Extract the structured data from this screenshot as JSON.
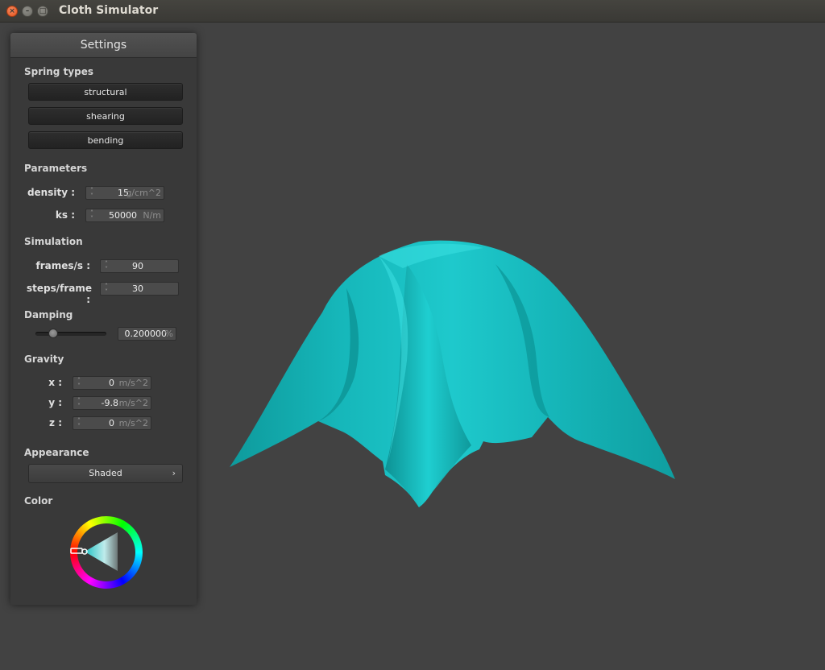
{
  "window": {
    "title": "Cloth Simulator",
    "close_glyph": "×",
    "minimize_glyph": "–",
    "maximize_glyph": "□"
  },
  "settings": {
    "header": "Settings",
    "spring_types": {
      "label": "Spring types",
      "buttons": [
        "structural",
        "shearing",
        "bending"
      ]
    },
    "parameters": {
      "label": "Parameters",
      "density": {
        "label": "density :",
        "value": "15",
        "unit": "g/cm^2"
      },
      "ks": {
        "label": "ks :",
        "value": "50000",
        "unit": "N/m"
      }
    },
    "simulation": {
      "label": "Simulation",
      "fps": {
        "label": "frames/s :",
        "value": "90"
      },
      "steps": {
        "label": "steps/frame :",
        "value": "30"
      }
    },
    "damping": {
      "label": "Damping",
      "value": "0.200000",
      "unit": "%",
      "slider_fraction": 0.2
    },
    "gravity": {
      "label": "Gravity",
      "x": {
        "label": "x :",
        "value": "0",
        "unit": "m/s^2"
      },
      "y": {
        "label": "y :",
        "value": "-9.8",
        "unit": "m/s^2"
      },
      "z": {
        "label": "z :",
        "value": "0",
        "unit": "m/s^2"
      }
    },
    "appearance": {
      "label": "Appearance",
      "selected": "Shaded",
      "chevron": "›"
    },
    "color": {
      "label": "Color",
      "value": "#1fc2c4"
    }
  },
  "scene": {
    "cloth_color": "#17c3c6",
    "background": "#424242"
  }
}
